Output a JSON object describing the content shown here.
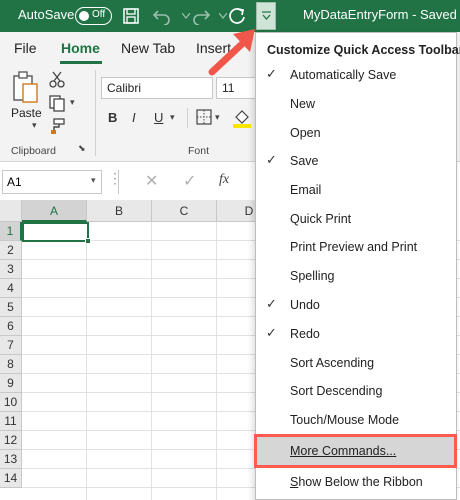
{
  "titlebar": {
    "autosave_label": "AutoSave",
    "autosave_state": "Off",
    "filename": "MyDataEntryForm  -  Saved",
    "icons": [
      "save-icon",
      "undo-icon",
      "redo-icon",
      "refresh-icon",
      "customize-qat-dropdown-icon"
    ]
  },
  "menubar": {
    "tabs": [
      {
        "label": "File"
      },
      {
        "label": "Home",
        "active": true
      },
      {
        "label": "New Tab"
      },
      {
        "label": "Insert"
      }
    ]
  },
  "ribbon": {
    "clipboard": {
      "paste_label": "Paste",
      "group_label": "Clipboard"
    },
    "font": {
      "font_name": "Calibri",
      "font_size": "11",
      "group_label": "Font",
      "bold": "B",
      "italic": "I",
      "underline": "U"
    }
  },
  "formula_bar": {
    "name_box": "A1",
    "fx": "fx"
  },
  "grid": {
    "columns": [
      "A",
      "B",
      "C",
      "D"
    ],
    "rows": [
      "1",
      "2",
      "3",
      "4",
      "5",
      "6",
      "7",
      "8",
      "9",
      "10",
      "11",
      "12",
      "13",
      "14"
    ],
    "active_cell": "A1"
  },
  "qat_menu": {
    "title": "Customize Quick Access Toolbar",
    "items": [
      {
        "label": "Automatically Save",
        "checked": true
      },
      {
        "label": "New",
        "checked": false
      },
      {
        "label": "Open",
        "checked": false
      },
      {
        "label": "Save",
        "checked": true
      },
      {
        "label": "Email",
        "checked": false
      },
      {
        "label": "Quick Print",
        "checked": false
      },
      {
        "label": "Print Preview and Print",
        "checked": false
      },
      {
        "label": "Spelling",
        "checked": false
      },
      {
        "label": "Undo",
        "checked": true
      },
      {
        "label": "Redo",
        "checked": true
      },
      {
        "label": "Sort Ascending",
        "checked": false
      },
      {
        "label": "Sort Descending",
        "checked": false
      },
      {
        "label": "Touch/Mouse Mode",
        "checked": false
      },
      {
        "label": "More Commands...",
        "checked": false,
        "highlighted": true
      },
      {
        "label": "Show Below the Ribbon",
        "checked": false
      }
    ]
  },
  "colors": {
    "excel_green": "#217346",
    "highlight_border": "#ff5a4e",
    "menu_hover": "#d6d6d6"
  }
}
